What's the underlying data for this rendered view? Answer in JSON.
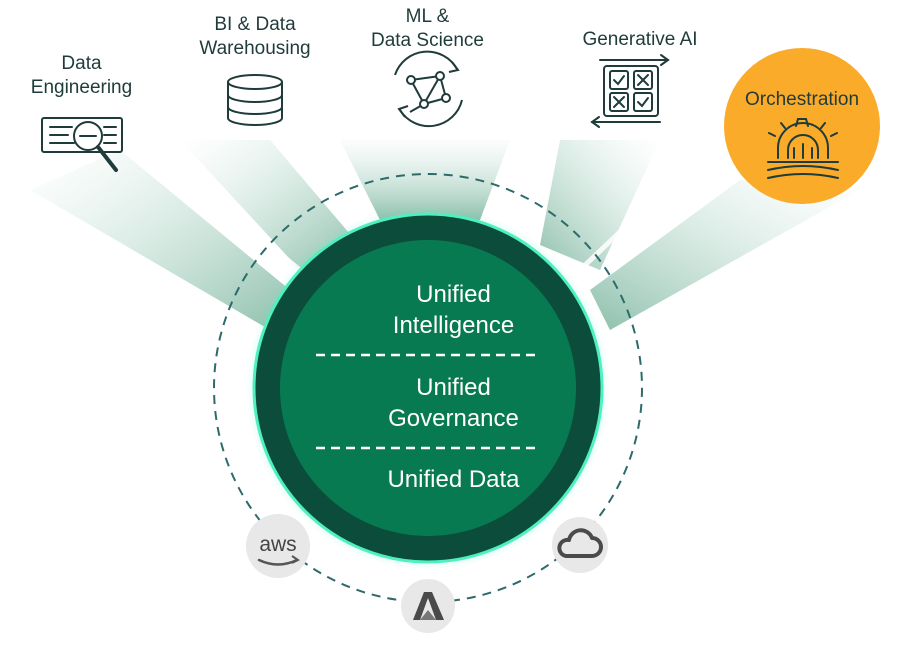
{
  "categories": [
    {
      "id": "data-engineering",
      "lines": [
        "Data",
        "Engineering"
      ],
      "highlighted": false
    },
    {
      "id": "bi-warehousing",
      "lines": [
        "BI & Data",
        "Warehousing"
      ],
      "highlighted": false
    },
    {
      "id": "ml-data-science",
      "lines": [
        "ML &",
        "Data Science"
      ],
      "highlighted": false
    },
    {
      "id": "generative-ai",
      "lines": [
        "Generative AI"
      ],
      "highlighted": false
    },
    {
      "id": "orchestration",
      "lines": [
        "Orchestration"
      ],
      "highlighted": true
    }
  ],
  "center": {
    "layers": [
      {
        "lines": [
          "Unified",
          "Intelligence"
        ]
      },
      {
        "lines": [
          "Unified",
          "Governance"
        ]
      },
      {
        "lines": [
          "Unified Data"
        ]
      }
    ]
  },
  "clouds": [
    {
      "name": "aws-logo-icon",
      "text": "aws"
    },
    {
      "name": "azure-logo-icon",
      "text": ""
    },
    {
      "name": "google-cloud-logo-icon",
      "text": ""
    }
  ],
  "colors": {
    "ring_outer": "#0b4d3a",
    "ring_inner": "#087a51",
    "ring_glow": "#4ff0c0",
    "highlight": "#fbab2a",
    "icon_stroke": "#1f3b3a",
    "text": "#1f3b3a",
    "beam": "#a8d6c4"
  }
}
